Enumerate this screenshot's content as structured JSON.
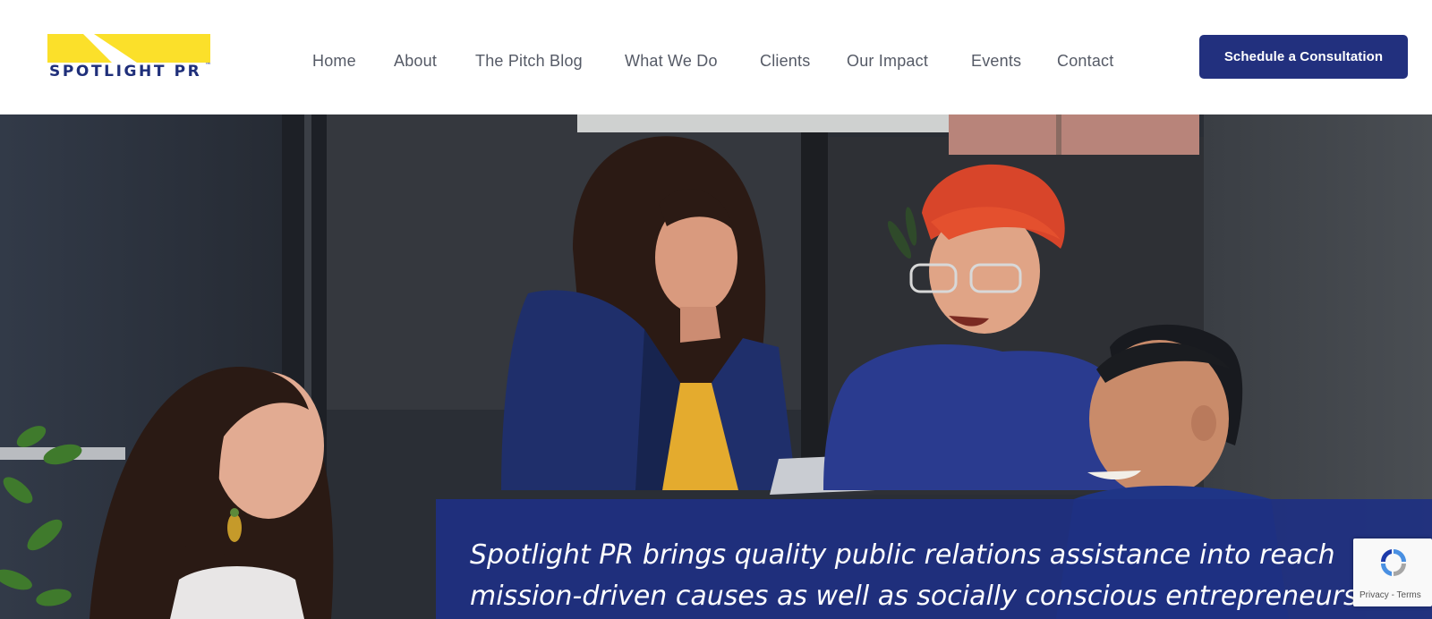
{
  "brand": {
    "name": "SPOTLIGHT PR",
    "trademark": "™",
    "colors": {
      "navy": "#22307e",
      "yellow": "#fbe02a"
    }
  },
  "nav": {
    "items": [
      {
        "label": "Home"
      },
      {
        "label": "About"
      },
      {
        "label": "The Pitch Blog"
      },
      {
        "label": "What We Do"
      },
      {
        "label": "Clients"
      },
      {
        "label": "Our Impact"
      },
      {
        "label": "Events"
      },
      {
        "label": "Contact"
      }
    ],
    "cta_label": "Schedule a Consultation"
  },
  "hero": {
    "image_icon": "team-photo",
    "tagline_line1": "Spotlight PR brings quality public relations assistance into reach",
    "tagline_line2": "mission-driven causes as well as socially conscious entrepreneurs"
  },
  "recaptcha": {
    "icon": "recaptcha-icon",
    "privacy_label": "Privacy",
    "separator": " - ",
    "terms_label": "Terms"
  }
}
